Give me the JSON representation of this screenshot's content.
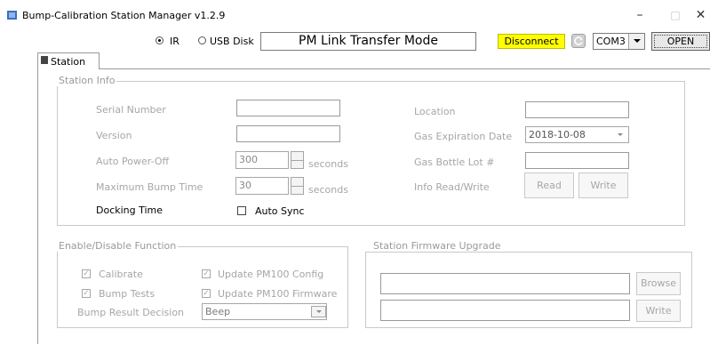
{
  "window": {
    "title": "Bump-Calibration Station Manager v1.2.9",
    "minimize_glyph": "–",
    "maximize_glyph": "□",
    "close_glyph": "✕"
  },
  "toolbar": {
    "radio_ir_label": "IR",
    "radio_usb_label": "USB Disk",
    "selected_mode": "IR",
    "mode_text": "PM Link Transfer Mode",
    "status_text": "Disconnect",
    "status_color": "#ffff00",
    "port_value": "COM3",
    "open_label": "OPEN"
  },
  "tabs": [
    {
      "label": "Station",
      "active": true
    }
  ],
  "station_info": {
    "title": "Station Info",
    "serial_number_label": "Serial Number",
    "serial_number_value": "",
    "version_label": "Version",
    "version_value": "",
    "auto_power_off_label": "Auto Power-Off",
    "auto_power_off_value": "300",
    "auto_power_off_unit": "seconds",
    "max_bump_time_label": "Maximum Bump Time",
    "max_bump_time_value": "30",
    "max_bump_time_unit": "seconds",
    "docking_time_label": "Docking Time",
    "auto_sync_label": "Auto Sync",
    "location_label": "Location",
    "location_value": "",
    "gas_expiration_label": "Gas Expiration Date",
    "gas_expiration_value": "2018-10-08",
    "gas_bottle_lot_label": "Gas Bottle Lot #",
    "gas_bottle_lot_value": "",
    "info_rw_label": "Info Read/Write",
    "read_label": "Read",
    "write_label": "Write"
  },
  "enable_disable": {
    "title": "Enable/Disable Function",
    "calibrate_label": "Calibrate",
    "bump_tests_label": "Bump Tests",
    "update_config_label": "Update PM100 Config",
    "update_firmware_label": "Update PM100 Firmware",
    "bump_result_label": "Bump Result Decision",
    "bump_result_value": "Beep",
    "check_glyph": "✓"
  },
  "firmware": {
    "title": "Station Firmware Upgrade",
    "path_value": "",
    "status_value": "",
    "browse_label": "Browse",
    "write_label": "Write"
  }
}
